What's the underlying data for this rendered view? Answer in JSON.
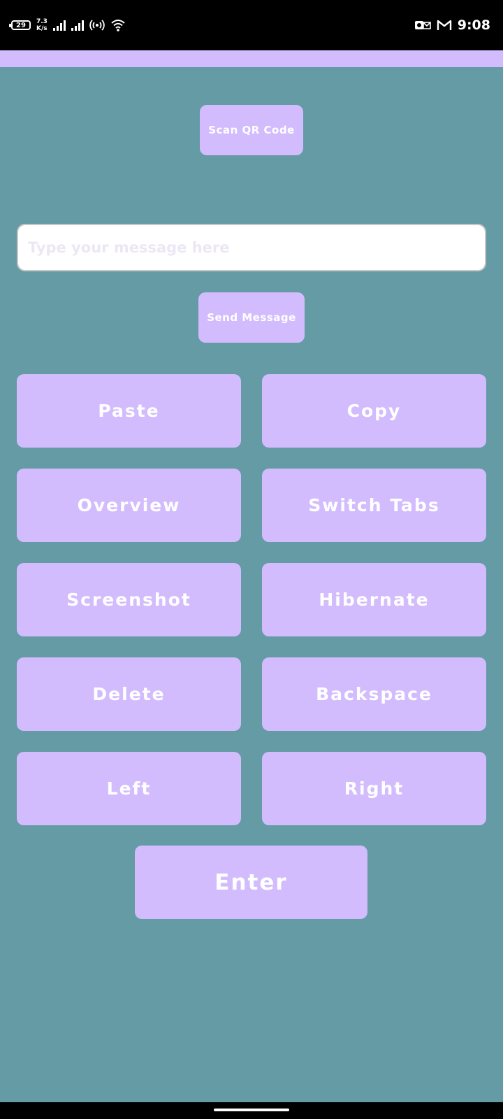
{
  "status_bar": {
    "battery_level": "29",
    "net_speed_value": "7.3",
    "net_speed_unit": "K/s",
    "time": "9:08",
    "icons": [
      "battery-icon",
      "signal-icon",
      "hotspot-icon",
      "wifi-icon",
      "outlook-icon",
      "gmail-icon"
    ]
  },
  "controls": {
    "scan_qr_label": "Scan QR Code",
    "message_placeholder": "Type your message here",
    "send_message_label": "Send Message"
  },
  "keys": {
    "paste": "Paste",
    "copy": "Copy",
    "overview": "Overview",
    "switch_tabs": "Switch Tabs",
    "screenshot": "Screenshot",
    "hibernate": "Hibernate",
    "delete": "Delete",
    "backspace": "Backspace",
    "left": "Left",
    "right": "Right",
    "enter": "Enter"
  },
  "colors": {
    "background": "#649ba5",
    "accent": "#d2bcfd",
    "button_text": "#ffffff",
    "status_bar": "#000000"
  }
}
